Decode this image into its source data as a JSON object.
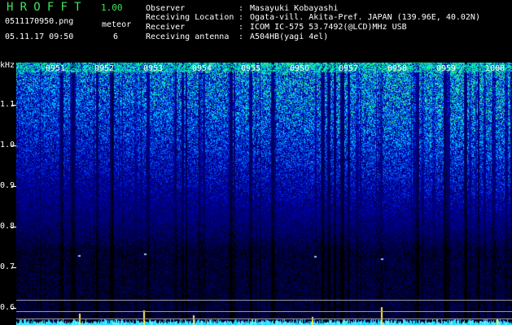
{
  "header": {
    "app_title": "HROFFT",
    "app_version": "1.00",
    "file_name": "0511170950.png",
    "timestamp": "05.11.17 09:50",
    "meteor_label": "meteor",
    "meteor_count": "6"
  },
  "info": [
    {
      "key": "Observer",
      "value": "Masayuki Kobayashi"
    },
    {
      "key": "Receiving Location",
      "value": "Ogata-vill. Akita-Pref. JAPAN (139.96E, 40.02N)"
    },
    {
      "key": "Receiver",
      "value": "ICOM IC-575 53.7492(@LCD)MHz USB"
    },
    {
      "key": "Receiving antenna",
      "value": "A504HB(yagi 4el)"
    }
  ],
  "spectrogram": {
    "y_unit": "kHz",
    "y_ticks": [
      "1.1",
      "1.0",
      "0.9",
      "0.8",
      "0.7",
      "0.6"
    ],
    "x_ticks": [
      "0951",
      "0952",
      "0953",
      "0954",
      "0955",
      "0956",
      "0957",
      "0958",
      "0959",
      "1000"
    ],
    "colors": {
      "background": "#000000",
      "low": "#0a1ea0",
      "mid": "#1f5cff",
      "high": "#3cff8a",
      "peak": "#ffe84a"
    }
  }
}
